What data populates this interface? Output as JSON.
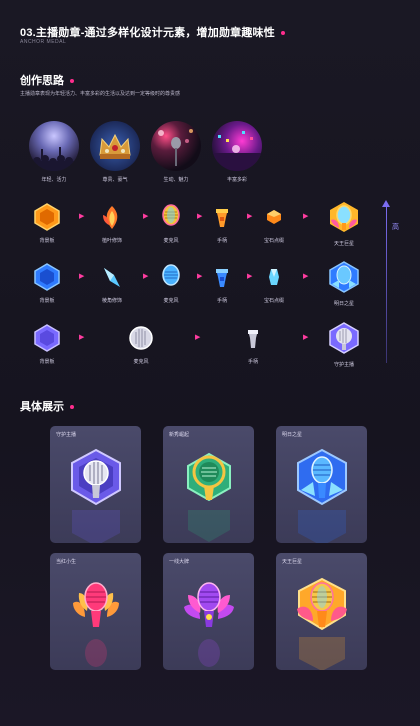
{
  "header": {
    "title": "03.主播勋章-通过多样化设计元素，增加勋章趣味性",
    "subtitle": "ANCHOR MEDAL"
  },
  "concept": {
    "heading": "创作思路",
    "description": "主播勋章表现为年轻活力、丰富多彩的生活以及达到一定等级时的尊贵感",
    "moods": [
      {
        "label": "年轻、活力"
      },
      {
        "label": "尊贵、豪气"
      },
      {
        "label": "生动、魅力"
      },
      {
        "label": "丰富多彩"
      }
    ]
  },
  "rows": [
    {
      "items": [
        {
          "label": "背景板",
          "icon": "orange-hexagon-icon"
        },
        {
          "label": "植叶修饰",
          "icon": "flame-leaf-icon"
        },
        {
          "label": "麦克风",
          "icon": "gold-mic-icon"
        },
        {
          "label": "手柄",
          "icon": "gold-handle-icon"
        },
        {
          "label": "宝石点缀",
          "icon": "orange-gem-icon"
        },
        {
          "label": "天王巨星",
          "icon": "superstar-medal-icon"
        }
      ]
    },
    {
      "items": [
        {
          "label": "背景板",
          "icon": "blue-hexagon-icon"
        },
        {
          "label": "棱角修饰",
          "icon": "blue-wing-icon"
        },
        {
          "label": "麦克风",
          "icon": "blue-mic-icon"
        },
        {
          "label": "手柄",
          "icon": "blue-handle-icon"
        },
        {
          "label": "宝石点缀",
          "icon": "blue-gem-icon"
        },
        {
          "label": "明日之星",
          "icon": "tomorrow-star-medal-icon"
        }
      ]
    },
    {
      "items": [
        {
          "label": "背景板",
          "icon": "purple-hexagon-icon"
        },
        {
          "label": "麦克风",
          "icon": "silver-mic-icon"
        },
        {
          "label": "手柄",
          "icon": "silver-handle-icon"
        },
        {
          "label": "守护主播",
          "icon": "guardian-medal-icon"
        }
      ]
    }
  ],
  "axis": {
    "label": "高"
  },
  "showcase": {
    "heading": "具体展示",
    "cards": [
      {
        "name": "守护主播",
        "icon": "guardian-medal-icon"
      },
      {
        "name": "新秀崛起",
        "icon": "rising-star-medal-icon"
      },
      {
        "name": "明日之星",
        "icon": "tomorrow-star-medal-icon"
      },
      {
        "name": "当红小生",
        "icon": "popular-star-medal-icon"
      },
      {
        "name": "一线大牌",
        "icon": "top-tier-medal-icon"
      },
      {
        "name": "天王巨星",
        "icon": "superstar-medal-icon"
      }
    ]
  },
  "colors": {
    "background": "#17151f",
    "accent_pink": "#ff2d8d",
    "axis_purple": "#7b6cf0",
    "card": "#44435f"
  }
}
